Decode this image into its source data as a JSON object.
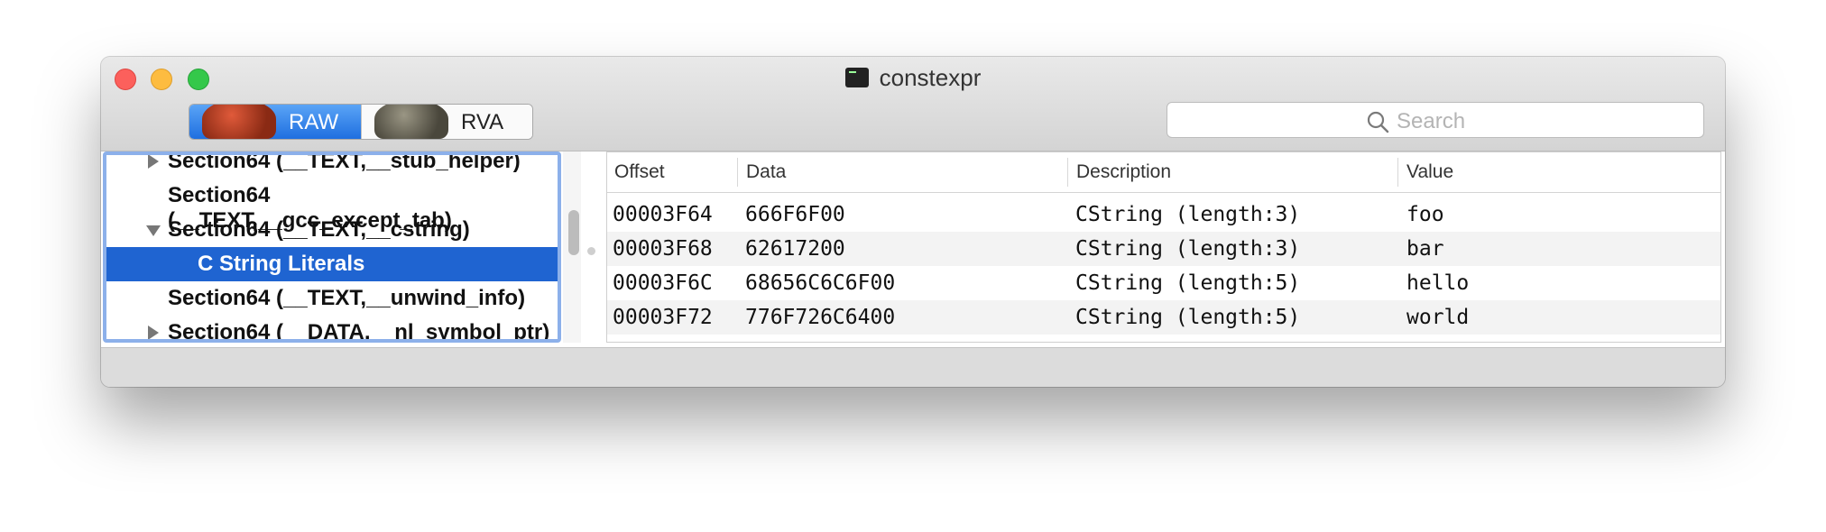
{
  "window": {
    "title": "constexpr"
  },
  "view_mode": {
    "options": [
      "RAW",
      "RVA"
    ],
    "selected": "RAW"
  },
  "search": {
    "placeholder": "Search"
  },
  "sidebar": {
    "items": [
      {
        "label": "Section64 (__TEXT,__stub_helper)",
        "disclosure": "collapsed"
      },
      {
        "label": "Section64 (__TEXT,__gcc_except_tab)",
        "disclosure": "none"
      },
      {
        "label": "Section64 (__TEXT,__cstring)",
        "disclosure": "expanded"
      },
      {
        "label": "C String Literals",
        "disclosure": "none",
        "selected": true
      },
      {
        "label": "Section64 (__TEXT,__unwind_info)",
        "disclosure": "none"
      },
      {
        "label": "Section64 (__DATA,__nl_symbol_ptr)",
        "disclosure": "collapsed"
      }
    ]
  },
  "table": {
    "columns": [
      "Offset",
      "Data",
      "Description",
      "Value"
    ],
    "rows": [
      [
        "00003F64",
        "666F6F00",
        "CString (length:3)",
        "foo"
      ],
      [
        "00003F68",
        "62617200",
        "CString (length:3)",
        "bar"
      ],
      [
        "00003F6C",
        "68656C6C6F00",
        "CString (length:5)",
        "hello"
      ],
      [
        "00003F72",
        "776F726C6400",
        "CString (length:5)",
        "world"
      ]
    ]
  },
  "icons": {
    "search": "search-icon",
    "window_icon": "terminal-icon"
  },
  "colors": {
    "selection": "#1f64d1",
    "segment_active": "#1f6fe0",
    "close": "#fc605c",
    "minimize": "#fdbc40",
    "zoom": "#34c84a"
  }
}
